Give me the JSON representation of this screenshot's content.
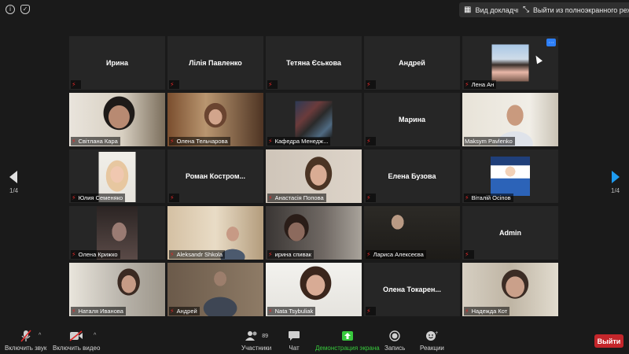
{
  "topbar": {
    "view_label": "Вид докладчика",
    "fullscreen_label": "Выйти из полноэкранного режима"
  },
  "paging": {
    "left": "1/4",
    "right": "1/4"
  },
  "tiles": [
    {
      "name": "Ирина",
      "type": "name"
    },
    {
      "name": "Лілія Павленко",
      "type": "name"
    },
    {
      "name": "Тетяна Єськова",
      "type": "name"
    },
    {
      "name": "Андрей",
      "type": "name"
    },
    {
      "name": "Лена Ан",
      "type": "photo"
    },
    {
      "name": "Світлана Кара",
      "type": "video"
    },
    {
      "name": "Олена Тельчарова",
      "type": "video"
    },
    {
      "name": "Кафедра Менедж...",
      "type": "photo"
    },
    {
      "name": "Марина",
      "type": "name"
    },
    {
      "name": "Maksym Pavlenko",
      "type": "video",
      "active": true
    },
    {
      "name": "Юлия Семеняко",
      "type": "photo"
    },
    {
      "name": "Роман Костром...",
      "type": "name"
    },
    {
      "name": "Анастасія Попова",
      "type": "video"
    },
    {
      "name": "Елена Бузова",
      "type": "name"
    },
    {
      "name": "Вiталiй Осiпов",
      "type": "photo"
    },
    {
      "name": "Олена Крижко",
      "type": "photo"
    },
    {
      "name": "Aleksandr Shkola",
      "type": "video"
    },
    {
      "name": "ирина спивак",
      "type": "video"
    },
    {
      "name": "Лариса Алексеєва",
      "type": "video"
    },
    {
      "name": "Admin",
      "type": "name"
    },
    {
      "name": "Наталя Иванова",
      "type": "video"
    },
    {
      "name": "Андрей",
      "type": "video"
    },
    {
      "name": "Nata Tsybuliak",
      "type": "video"
    },
    {
      "name": "Олена Токарен...",
      "type": "name"
    },
    {
      "name": "Надежда Кот",
      "type": "video"
    }
  ],
  "toolbar": {
    "unmute": "Включить звук",
    "start_video": "Включить видео",
    "participants": "Участники",
    "participants_count": "89",
    "chat": "Чат",
    "share": "Демонстрация экрана",
    "record": "Запись",
    "reactions": "Реакции",
    "leave": "Выйти"
  },
  "colors": {
    "background": "#1a1a1a",
    "tile": "#262626",
    "active_speaker": "#d9e34a",
    "muted_mic": "#e02828",
    "share_green": "#38c93d",
    "leave_red": "#c4262b",
    "accent_blue": "#2d7ff9"
  }
}
